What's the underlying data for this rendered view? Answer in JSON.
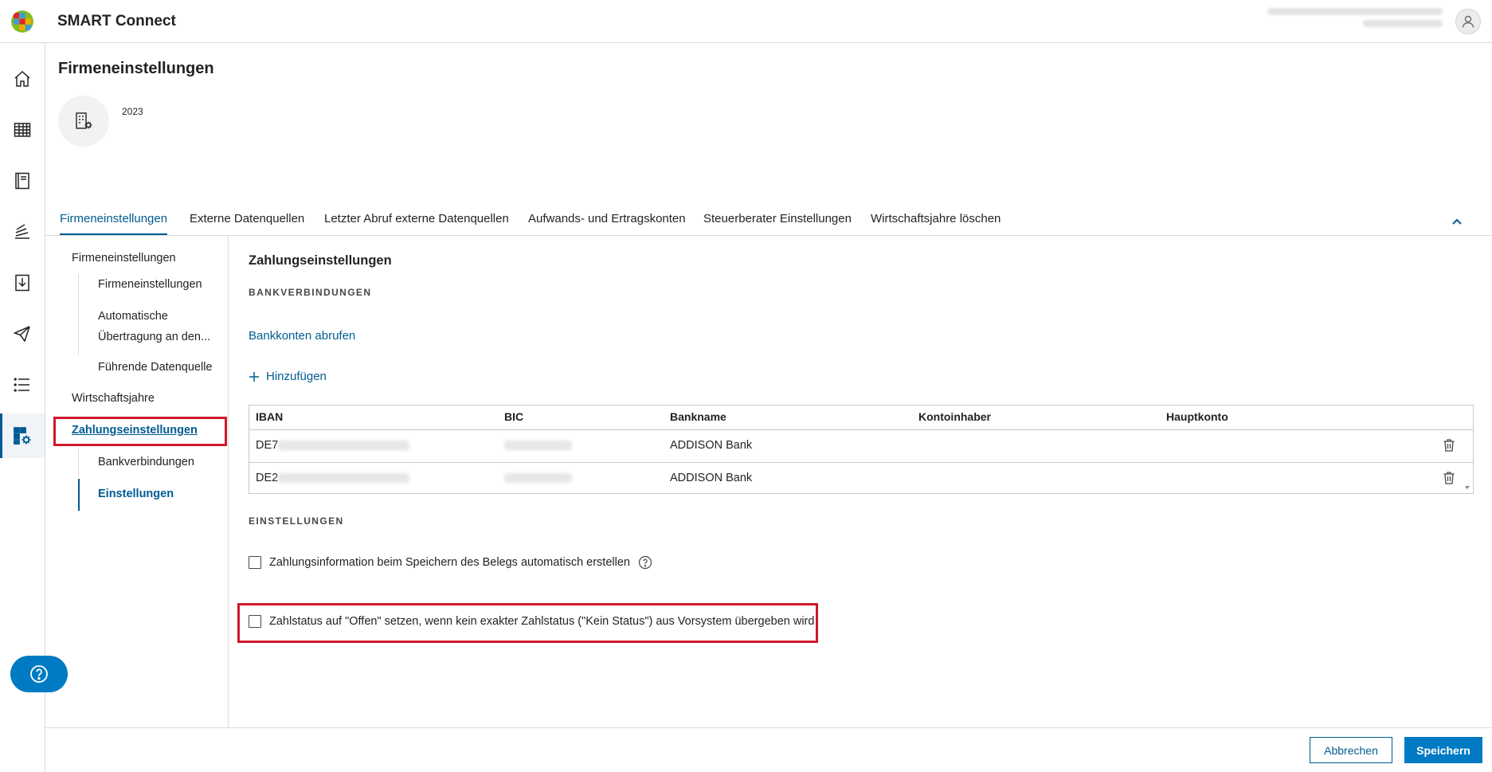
{
  "app": {
    "title": "SMART Connect"
  },
  "colors": {
    "brand": "#007ac3",
    "brand_dark": "#005b92",
    "highlight": "#d0182b"
  },
  "rail": {
    "items": [
      {
        "name": "home-icon"
      },
      {
        "name": "table-icon"
      },
      {
        "name": "ledger-icon"
      },
      {
        "name": "stack-icon"
      },
      {
        "name": "import-icon"
      },
      {
        "name": "send-icon"
      },
      {
        "name": "list-icon"
      },
      {
        "name": "company-settings-icon",
        "active": true
      }
    ],
    "help_icon": "question-circle-icon",
    "expand_icon": "double-chevron-right-icon"
  },
  "page": {
    "title": "Firmeneinstellungen",
    "company_year": "2023"
  },
  "tabs": [
    {
      "label": "Firmeneinstellungen",
      "active": true
    },
    {
      "label": "Externe Datenquellen"
    },
    {
      "label": "Letzter Abruf externe Datenquellen"
    },
    {
      "label": "Aufwands- und Ertragskonten"
    },
    {
      "label": "Steuerberater Einstellungen"
    },
    {
      "label": "Wirtschaftsjahre löschen"
    }
  ],
  "subnav": {
    "group1": "Firmeneinstellungen",
    "group1_items": [
      "Firmeneinstellungen",
      "Automatische Übertragung an den...",
      "Führende Datenquelle"
    ],
    "group2": "Wirtschaftsjahre",
    "group3": "Zahlungseinstellungen",
    "group3_items": [
      "Bankverbindungen",
      "Einstellungen"
    ]
  },
  "main": {
    "section_title": "Zahlungseinstellungen",
    "bank_caps": "BANKVERBINDUNGEN",
    "fetch_link": "Bankkonten abrufen",
    "add_label": "Hinzufügen",
    "table": {
      "headers": [
        "IBAN",
        "BIC",
        "Bankname",
        "Kontoinhaber",
        "Hauptkonto"
      ],
      "rows": [
        {
          "iban_prefix": "DE7",
          "bankname": "ADDISON Bank"
        },
        {
          "iban_prefix": "DE2",
          "bankname": "ADDISON Bank"
        }
      ]
    },
    "settings_caps": "EINSTELLUNGEN",
    "option1": "Zahlungsinformation beim Speichern des Belegs automatisch erstellen",
    "option2": "Zahlstatus auf \"Offen\" setzen, wenn kein exakter Zahlstatus (\"Kein Status\") aus Vorsystem übergeben wird"
  },
  "footer": {
    "cancel_label": "Abbrechen",
    "save_label": "Speichern"
  }
}
